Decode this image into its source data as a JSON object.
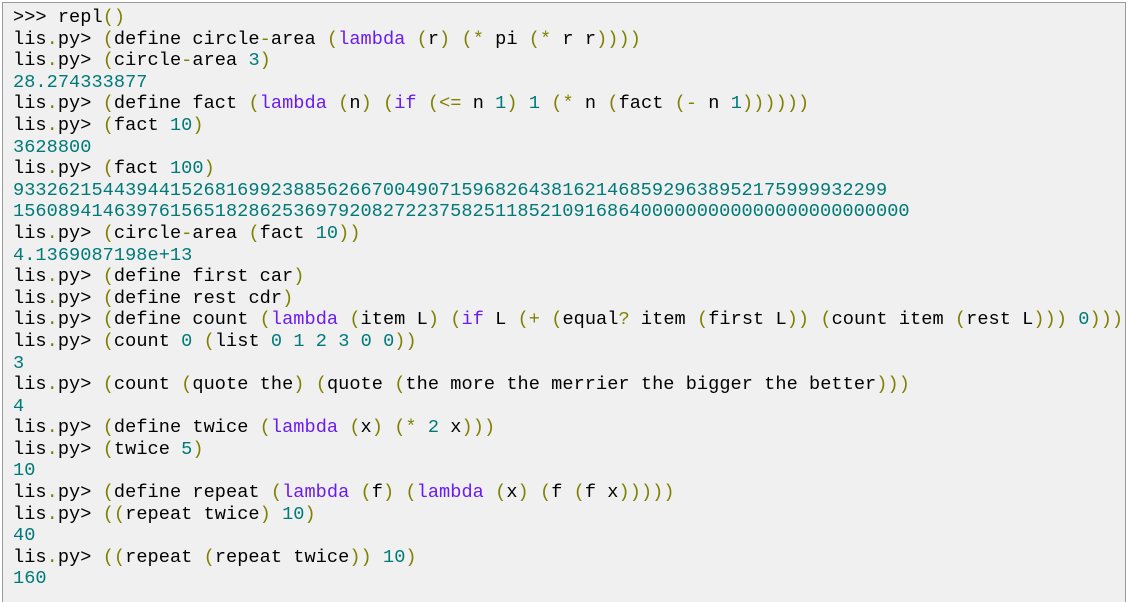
{
  "colors": {
    "punctuation": "#808000",
    "keyword": "#6a1cf0",
    "number": "#007a78",
    "text": "#000000",
    "background": "#f0f0f0"
  },
  "keywords": [
    "lambda",
    "if"
  ],
  "lines": [
    {
      "kind": "input",
      "prompt": ">>>",
      "code": "repl()"
    },
    {
      "kind": "input",
      "prompt": "lis.py>",
      "code": "(define circle-area (lambda (r) (* pi (* r r))))"
    },
    {
      "kind": "input",
      "prompt": "lis.py>",
      "code": "(circle-area 3)"
    },
    {
      "kind": "output",
      "text": "28.274333877"
    },
    {
      "kind": "input",
      "prompt": "lis.py>",
      "code": "(define fact (lambda (n) (if (<= n 1) 1 (* n (fact (- n 1))))))"
    },
    {
      "kind": "input",
      "prompt": "lis.py>",
      "code": "(fact 10)"
    },
    {
      "kind": "output",
      "text": "3628800"
    },
    {
      "kind": "input",
      "prompt": "lis.py>",
      "code": "(fact 100)"
    },
    {
      "kind": "output",
      "text": "933262154439441526816992388562667004907159682643816214685929638952175999932299"
    },
    {
      "kind": "output",
      "text": "15608941463976156518286253697920827223758251185210916864000000000000000000000000"
    },
    {
      "kind": "input",
      "prompt": "lis.py>",
      "code": "(circle-area (fact 10))"
    },
    {
      "kind": "output",
      "text": "4.1369087198e+13"
    },
    {
      "kind": "input",
      "prompt": "lis.py>",
      "code": "(define first car)"
    },
    {
      "kind": "input",
      "prompt": "lis.py>",
      "code": "(define rest cdr)"
    },
    {
      "kind": "input",
      "prompt": "lis.py>",
      "code": "(define count (lambda (item L) (if L (+ (equal? item (first L)) (count item (rest L))) 0)))"
    },
    {
      "kind": "input",
      "prompt": "lis.py>",
      "code": "(count 0 (list 0 1 2 3 0 0))"
    },
    {
      "kind": "output",
      "text": "3"
    },
    {
      "kind": "input",
      "prompt": "lis.py>",
      "code": "(count (quote the) (quote (the more the merrier the bigger the better)))"
    },
    {
      "kind": "output",
      "text": "4"
    },
    {
      "kind": "input",
      "prompt": "lis.py>",
      "code": "(define twice (lambda (x) (* 2 x)))"
    },
    {
      "kind": "input",
      "prompt": "lis.py>",
      "code": "(twice 5)"
    },
    {
      "kind": "output",
      "text": "10"
    },
    {
      "kind": "input",
      "prompt": "lis.py>",
      "code": "(define repeat (lambda (f) (lambda (x) (f (f x)))))"
    },
    {
      "kind": "input",
      "prompt": "lis.py>",
      "code": "((repeat twice) 10)"
    },
    {
      "kind": "output",
      "text": "40"
    },
    {
      "kind": "input",
      "prompt": "lis.py>",
      "code": "((repeat (repeat twice)) 10)"
    },
    {
      "kind": "output",
      "text": "160"
    }
  ]
}
